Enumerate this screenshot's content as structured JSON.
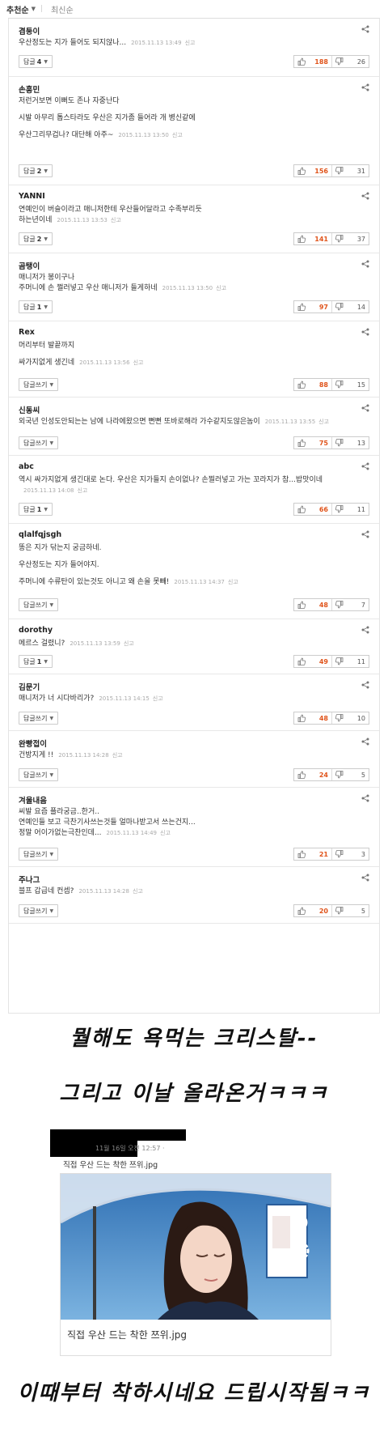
{
  "sort_bar": {
    "recommended": "추천순",
    "latest": "최신순"
  },
  "comments": [
    {
      "author": "겸둥이",
      "body": [
        "우산정도는 지가 들어도 되지않나..."
      ],
      "time": "2015.11.13 13:49",
      "report": "신고",
      "reply_label": "답글",
      "reply_count": "4",
      "likes": "188",
      "dislikes": "26"
    },
    {
      "author": "손흥민",
      "body": [
        "저런거보면 이뻐도 존나 자중난다",
        "",
        "시발 아무리 톱스타라도 우산은 지가좀 들어라 개 병신같에",
        "",
        "우산그리무겁나? 대단해 아주~"
      ],
      "time": "2015.11.13 13:50",
      "report": "신고",
      "reply_label": "답글",
      "reply_count": "2",
      "likes": "156",
      "dislikes": "31"
    },
    {
      "author": "YANNI",
      "body": [
        "연예인이 버슬이라고 매니저한테 우산들어달라고 수족부리듯",
        "하는년이네"
      ],
      "time": "2015.11.13 13:53",
      "report": "신고",
      "reply_label": "답글",
      "reply_count": "2",
      "likes": "141",
      "dislikes": "37"
    },
    {
      "author": "곰탱이",
      "body": [
        "매니저가 봉이구나",
        "주머니에 손 쩔러넣고 우산 매니저가 들게하네"
      ],
      "time": "2015.11.13 13:50",
      "report": "신고",
      "reply_label": "답글",
      "reply_count": "1",
      "likes": "97",
      "dislikes": "14"
    },
    {
      "author": "Rex",
      "body": [
        "머리부터 발끝까지",
        "",
        "싸가지없게 생긴네"
      ],
      "time": "2015.11.13 13:56",
      "report": "신고",
      "reply_label": "답글쓰기",
      "reply_count": "",
      "likes": "88",
      "dislikes": "15"
    },
    {
      "author": "신동씨",
      "body": [
        "외국년 인성도안되는는 남에 나라에왔으면 뻔뻔 또바로해라 가수같지도않은놈이"
      ],
      "time": "2015.11.13 13:55",
      "report": "신고",
      "reply_label": "답글쓰기",
      "reply_count": "",
      "likes": "75",
      "dislikes": "13"
    },
    {
      "author": "abc",
      "body": [
        "역시 싸가지없게 생긴대로 논다. 우산은 지가들지 손이없나? 손찔러넣고 가는 꼬라지가 참...밥맛이네"
      ],
      "time": "2015.11.13 14:08",
      "report": "신고",
      "reply_label": "답글",
      "reply_count": "1",
      "likes": "66",
      "dislikes": "11"
    },
    {
      "author": "qlalfqjsgh",
      "body": [
        "똥은 지가 닦는지 궁금하네.",
        "",
        "우산정도는 지가 들어야지.",
        "",
        "주머니에 수류탄이 있는것도 아니고 왜 손을 못빼!"
      ],
      "time": "2015.11.13 14:37",
      "report": "신고",
      "reply_label": "답글쓰기",
      "reply_count": "",
      "likes": "48",
      "dislikes": "7"
    },
    {
      "author": "dorothy",
      "body": [
        "메르스 걸렸니?"
      ],
      "time": "2015.11.13 13:59",
      "report": "신고",
      "reply_label": "답글",
      "reply_count": "1",
      "likes": "49",
      "dislikes": "11"
    },
    {
      "author": "김문기",
      "body": [
        "매니저가 너 시다바리가?"
      ],
      "time": "2015.11.13 14:15",
      "report": "신고",
      "reply_label": "답글쓰기",
      "reply_count": "",
      "likes": "48",
      "dislikes": "10"
    },
    {
      "author": "완빵접이",
      "body": [
        "건방지게 !!"
      ],
      "time": "2015.11.13 14:28",
      "report": "신고",
      "reply_label": "답글쓰기",
      "reply_count": "",
      "likes": "24",
      "dislikes": "5"
    },
    {
      "author": "겨울내음",
      "body": [
        "씨발 요즘 플라궁금..한거..",
        "연예인들 보고 극찬기사쓰는것들 얼마나받고서 쓰는건지...",
        "정말 어이가없는극찬인데..."
      ],
      "time": "2015.11.13 14:49",
      "report": "신고",
      "reply_label": "답글쓰기",
      "reply_count": "",
      "likes": "21",
      "dislikes": "3"
    },
    {
      "author": "주나그",
      "body": [
        "블프 갑급네 컨셉?"
      ],
      "time": "2015.11.13 14:28",
      "report": "신고",
      "reply_label": "답글쓰기",
      "reply_count": "",
      "likes": "20",
      "dislikes": "5"
    }
  ],
  "captions": {
    "first": "뭘해도 욕먹는 크리스탈--",
    "second": "그리고 이날 올라온거ㅋㅋㅋ",
    "third": "이때부터 착하시네요 드립시작됨ㅋㅋ"
  },
  "post": {
    "time": "11월 16일 오전 12:57 ·",
    "text": "직접 우산 드는 착한 쯔위.jpg",
    "card_title": "직접 우산 드는 착한 쯔위.jpg"
  },
  "colors": {
    "like": "#e0541b",
    "border": "#dddddd",
    "meta": "#aaaaaa"
  }
}
